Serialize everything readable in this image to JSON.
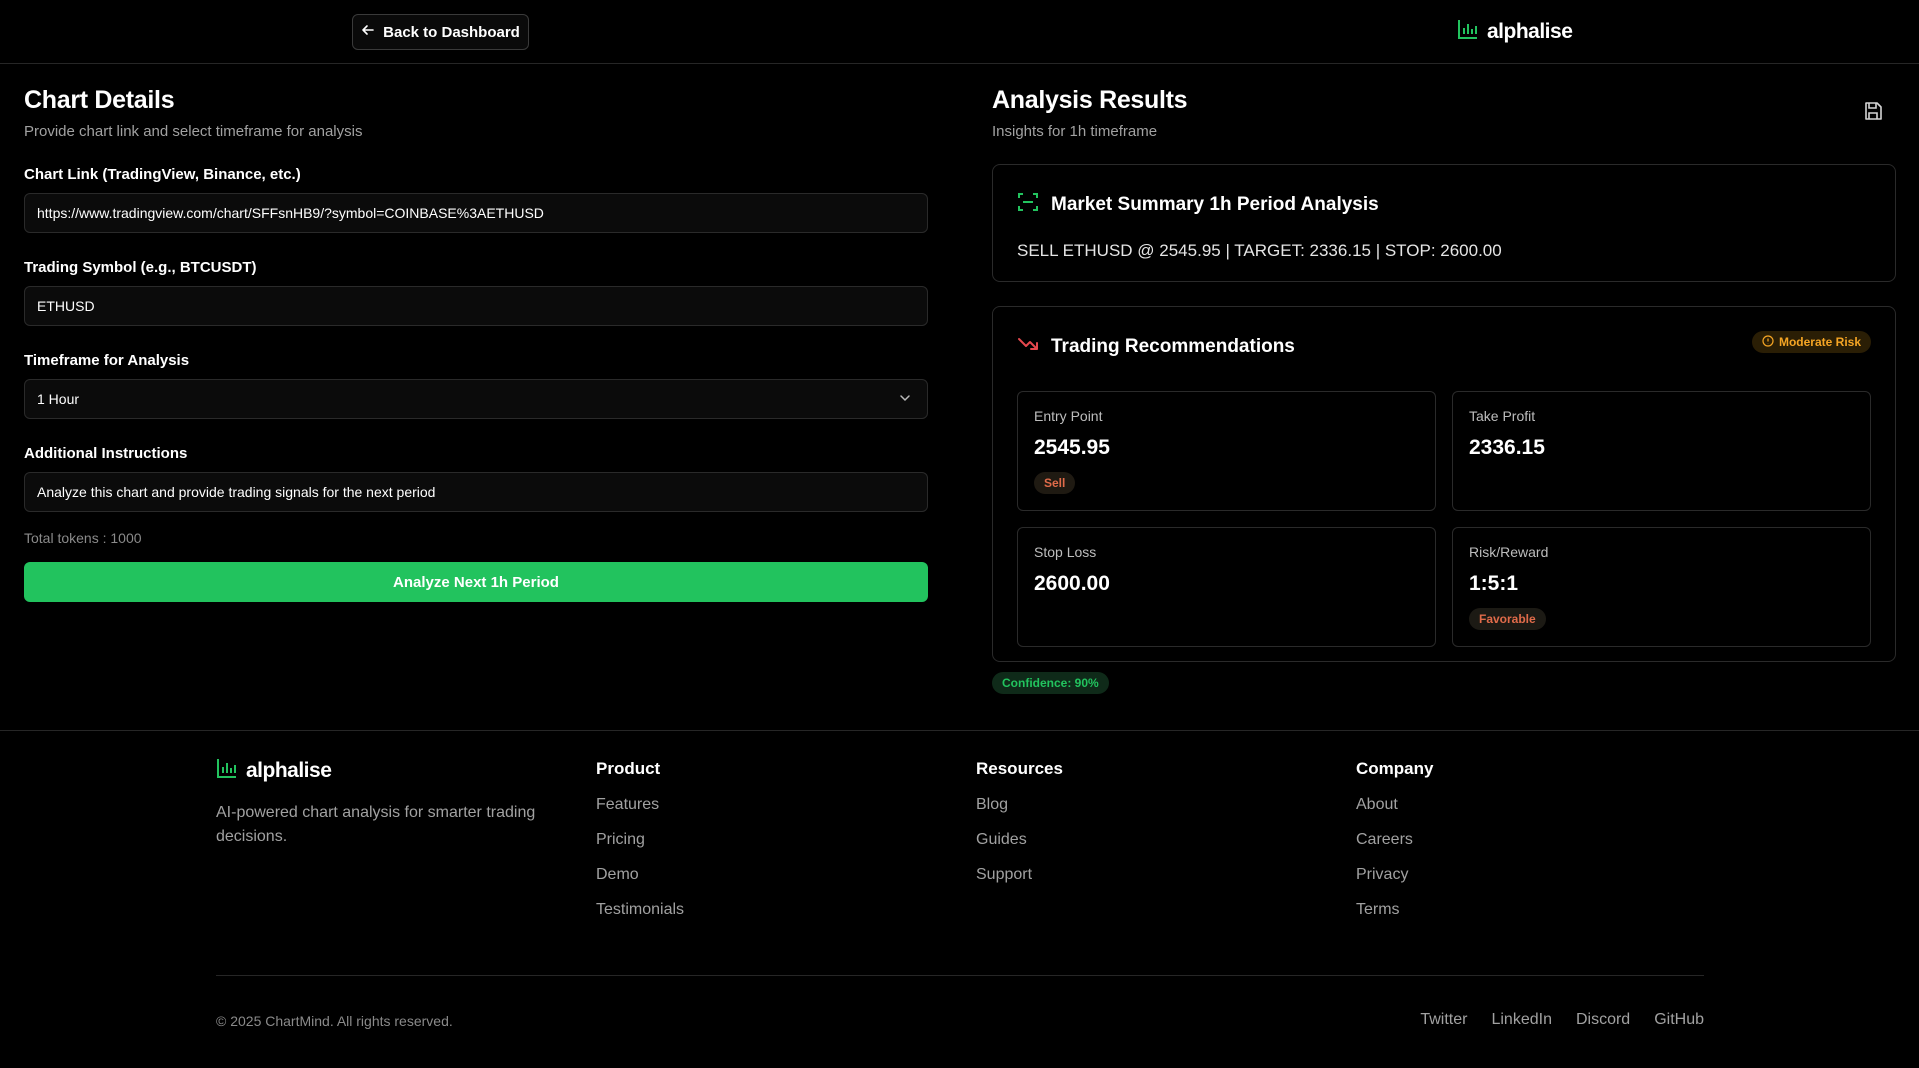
{
  "header": {
    "back_label": "Back to Dashboard",
    "brand": "alphalise"
  },
  "chart_details": {
    "title": "Chart Details",
    "subtitle": "Provide chart link and select timeframe for analysis",
    "chart_link_label": "Chart Link (TradingView, Binance, etc.)",
    "chart_link_value": "https://www.tradingview.com/chart/SFFsnHB9/?symbol=COINBASE%3AETHUSD",
    "symbol_label": "Trading Symbol (e.g., BTCUSDT)",
    "symbol_value": "ETHUSD",
    "timeframe_label": "Timeframe for Analysis",
    "timeframe_value": "1 Hour",
    "instructions_label": "Additional Instructions",
    "instructions_value": "Analyze this chart and provide trading signals for the next period",
    "tokens": "Total tokens : 1000",
    "analyze_label": "Analyze Next 1h Period"
  },
  "analysis": {
    "title": "Analysis Results",
    "subtitle": "Insights for 1h timeframe",
    "summary_title": "Market Summary 1h Period Analysis",
    "summary_text": "SELL ETHUSD @ 2545.95 | TARGET: 2336.15 | STOP: 2600.00",
    "reco_title": "Trading Recommendations",
    "risk_badge": "Moderate Risk",
    "entry_label": "Entry Point",
    "entry_value": "2545.95",
    "entry_pill": "Sell",
    "tp_label": "Take Profit",
    "tp_value": "2336.15",
    "sl_label": "Stop Loss",
    "sl_value": "2600.00",
    "rr_label": "Risk/Reward",
    "rr_value": "1:5:1",
    "rr_pill": "Favorable",
    "confidence": "Confidence: 90%"
  },
  "footer": {
    "brand": "alphalise",
    "tagline": "AI-powered chart analysis for smarter trading decisions.",
    "product_title": "Product",
    "product_links": [
      "Features",
      "Pricing",
      "Demo",
      "Testimonials"
    ],
    "resources_title": "Resources",
    "resources_links": [
      "Blog",
      "Guides",
      "Support"
    ],
    "company_title": "Company",
    "company_links": [
      "About",
      "Careers",
      "Privacy",
      "Terms"
    ],
    "copyright": "© 2025 ChartMind. All rights reserved.",
    "social": [
      "Twitter",
      "LinkedIn",
      "Discord",
      "GitHub"
    ]
  },
  "colors": {
    "accent": "#22c35e",
    "warning": "#f5a524",
    "danger": "#e06b4a",
    "background": "#000000"
  }
}
